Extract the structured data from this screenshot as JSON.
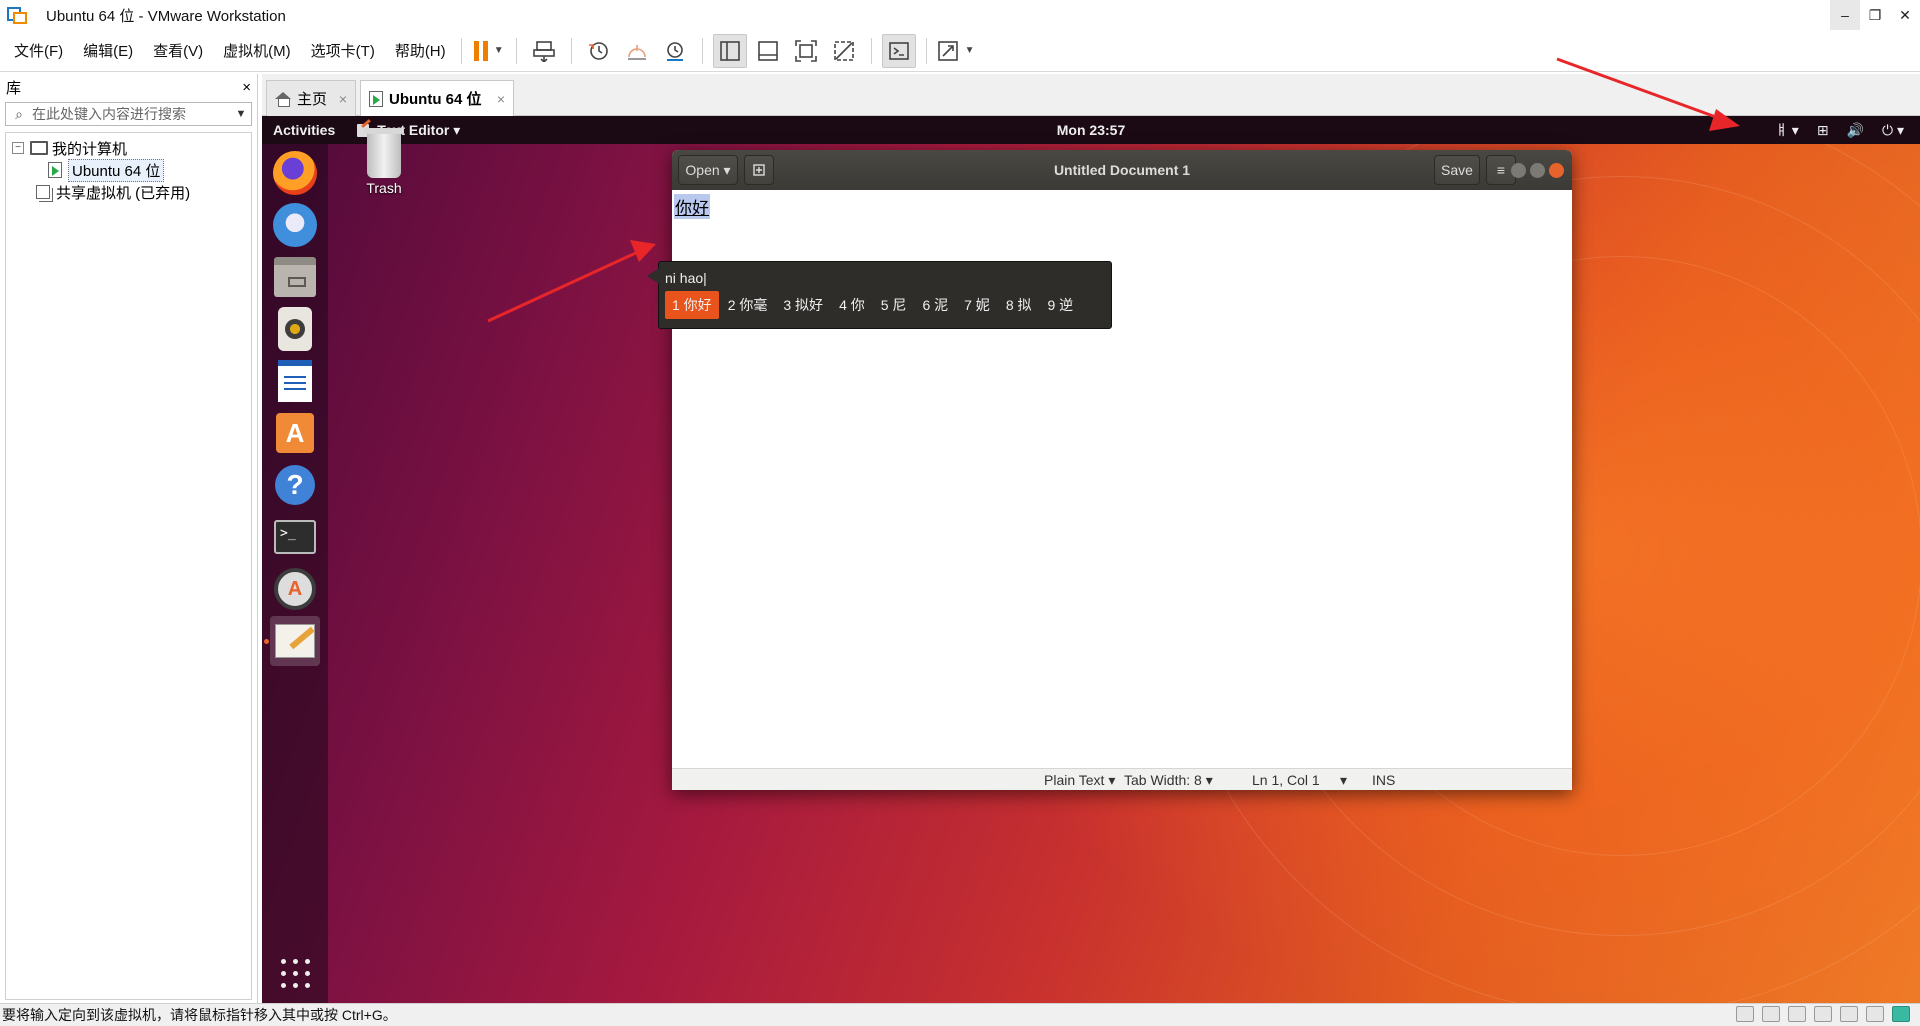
{
  "window": {
    "title": "Ubuntu 64 位 - VMware Workstation",
    "controls": {
      "minimize": "–",
      "restore": "❐",
      "close": "✕"
    }
  },
  "menu": [
    "文件(F)",
    "编辑(E)",
    "查看(V)",
    "虚拟机(M)",
    "选项卡(T)",
    "帮助(H)"
  ],
  "library": {
    "title": "库",
    "close": "×",
    "search_placeholder": "在此处键入内容进行搜索",
    "tree": {
      "my_computer": "我的计算机",
      "vm": "Ubuntu 64 位",
      "shared": "共享虚拟机 (已弃用)"
    }
  },
  "tabs": {
    "home": "主页",
    "active": "Ubuntu 64 位",
    "close": "×"
  },
  "ubuntu": {
    "topbar": {
      "activities": "Activities",
      "app": "Text Editor ▾",
      "clock": "Mon 23:57",
      "input_method": "ㅒ ▾",
      "network": "⊞",
      "volume": "🔊",
      "power": "⏻ ▾"
    },
    "desktop": {
      "trash": "Trash"
    },
    "dock": {
      "items": [
        "firefox-icon",
        "thunderbird-icon",
        "files-icon",
        "rhythmbox-icon",
        "writer-icon",
        "software-icon",
        "help-icon",
        "terminal-icon",
        "updater-icon",
        "gedit-icon"
      ],
      "software_glyph": "A",
      "help_glyph": "?",
      "terminal_glyph": ">_",
      "updater_glyph": "A"
    },
    "gedit": {
      "open": "Open ▾",
      "save": "Save",
      "menu": "≡",
      "title": "Untitled Document 1",
      "content": "你好",
      "status": {
        "language": "Plain Text ▾",
        "tab_width": "Tab Width: 8 ▾",
        "position": "Ln 1, Col 1",
        "pos_dropdown": "▾",
        "mode": "INS"
      }
    },
    "ime": {
      "preedit": "ni hao|",
      "candidates": [
        "1 你好",
        "2 你毫",
        "3 拟好",
        "4 你",
        "5 尼",
        "6 泥",
        "7 妮",
        "8 拟",
        "9 逆"
      ]
    }
  },
  "statusbar": {
    "message": "要将输入定向到该虚拟机，请将鼠标指针移入其中或按 Ctrl+G。"
  },
  "colors": {
    "accent": "#e8541c",
    "vmware_pause": "#f07d00",
    "annotation_arrow": "#e8262a"
  }
}
